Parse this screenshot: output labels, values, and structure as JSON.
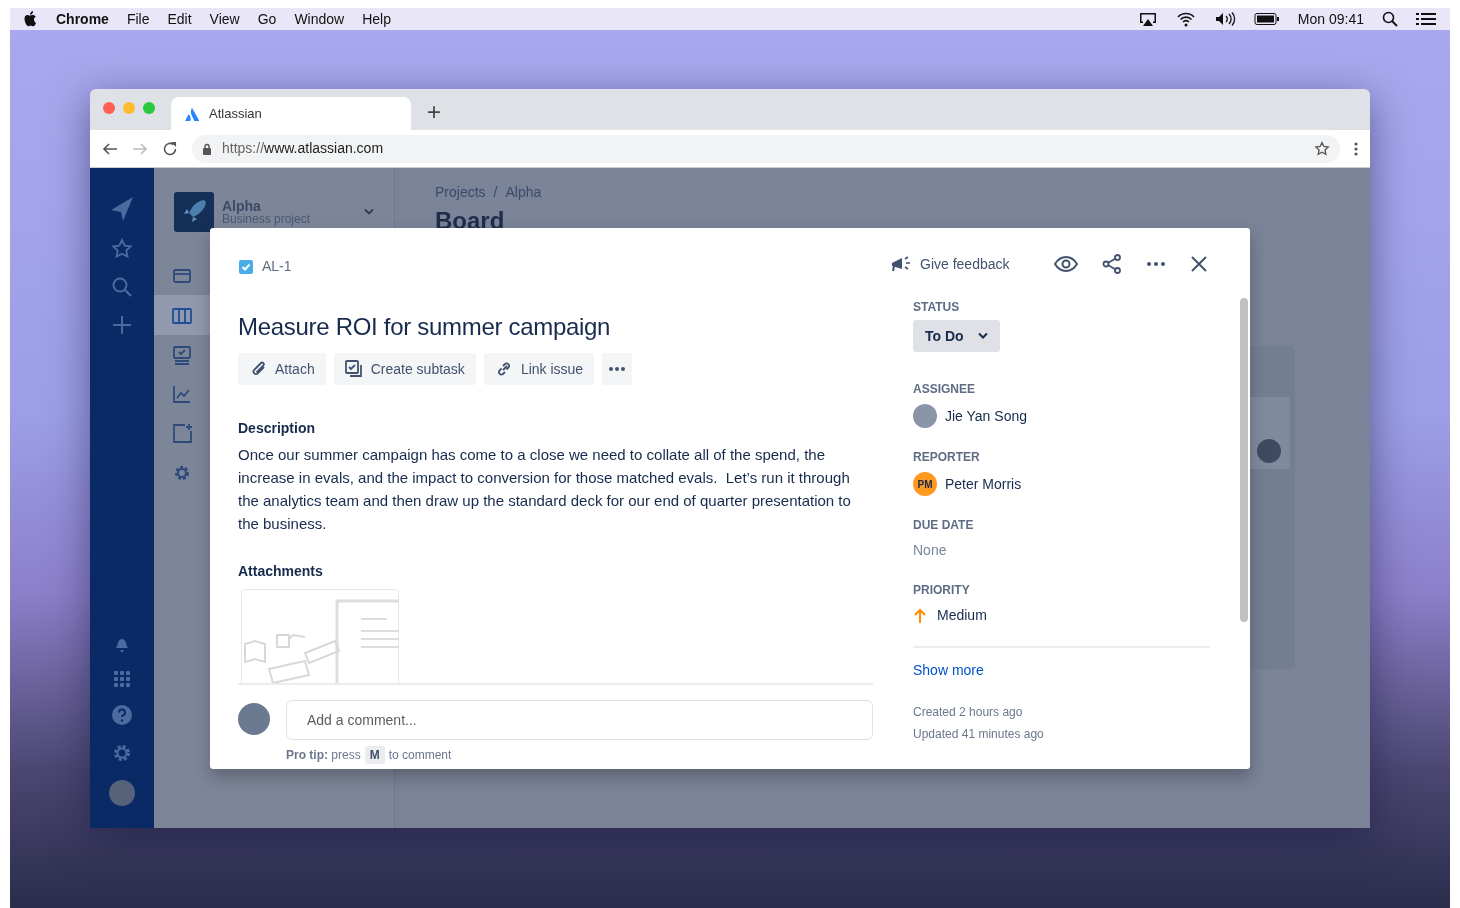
{
  "menubar": {
    "app": "Chrome",
    "menus": [
      "File",
      "Edit",
      "View",
      "Go",
      "Window",
      "Help"
    ],
    "clock": "Mon 09:41"
  },
  "browser": {
    "tab_title": "Atlassian",
    "new_tab": "+",
    "url_scheme": "https://",
    "url_host": "www.atlassian.com"
  },
  "project_sidebar": {
    "name": "Alpha",
    "type": "Business project",
    "nav": [
      {
        "selected": false
      },
      {
        "selected": true
      },
      {
        "selected": false
      },
      {
        "selected": false
      },
      {
        "selected": false
      },
      {
        "selected": false
      }
    ]
  },
  "breadcrumbs": [
    "Projects",
    "Alpha"
  ],
  "breadcrumb_separator": "/",
  "page_title": "Board",
  "issue": {
    "key": "AL-1",
    "title": "Measure ROI for summer campaign",
    "actions": [
      {
        "kind": "attach",
        "label": "Attach"
      },
      {
        "kind": "subtask",
        "label": "Create subtask"
      },
      {
        "kind": "link",
        "label": "Link issue"
      },
      {
        "kind": "more"
      }
    ],
    "description_heading": "Description",
    "description": "Once our summer campaign has come to a close we need to collate all of the spend, the increase in evals, and the impact to conversion for those matched evals.  Let’s run it through the analytics team and then draw up the standard deck for our end of quarter presentation to the business.",
    "attachments_heading": "Attachments",
    "comment": {
      "placeholder": "Add a comment...",
      "tip": "**Pro tip:** press",
      "key": "M",
      "tip_end": "to comment"
    }
  },
  "header": {
    "feedback": "Give feedback"
  },
  "fields": [
    {
      "kind": "status",
      "label": "STATUS",
      "value": "To Do"
    },
    {
      "kind": "user",
      "label": "ASSIGNEE",
      "value": "Jie Yan Song"
    },
    {
      "kind": "user",
      "label": "REPORTER",
      "value": "Peter Morris",
      "initials": "PM",
      "color": "#ff991f"
    },
    {
      "kind": "empty",
      "label": "DUE DATE",
      "value": "None"
    },
    {
      "kind": "priority",
      "label": "PRIORITY",
      "value": "Medium"
    }
  ],
  "show_more": "Show more",
  "created": "Created 2 hours ago",
  "updated": "Updated 41 minutes ago"
}
